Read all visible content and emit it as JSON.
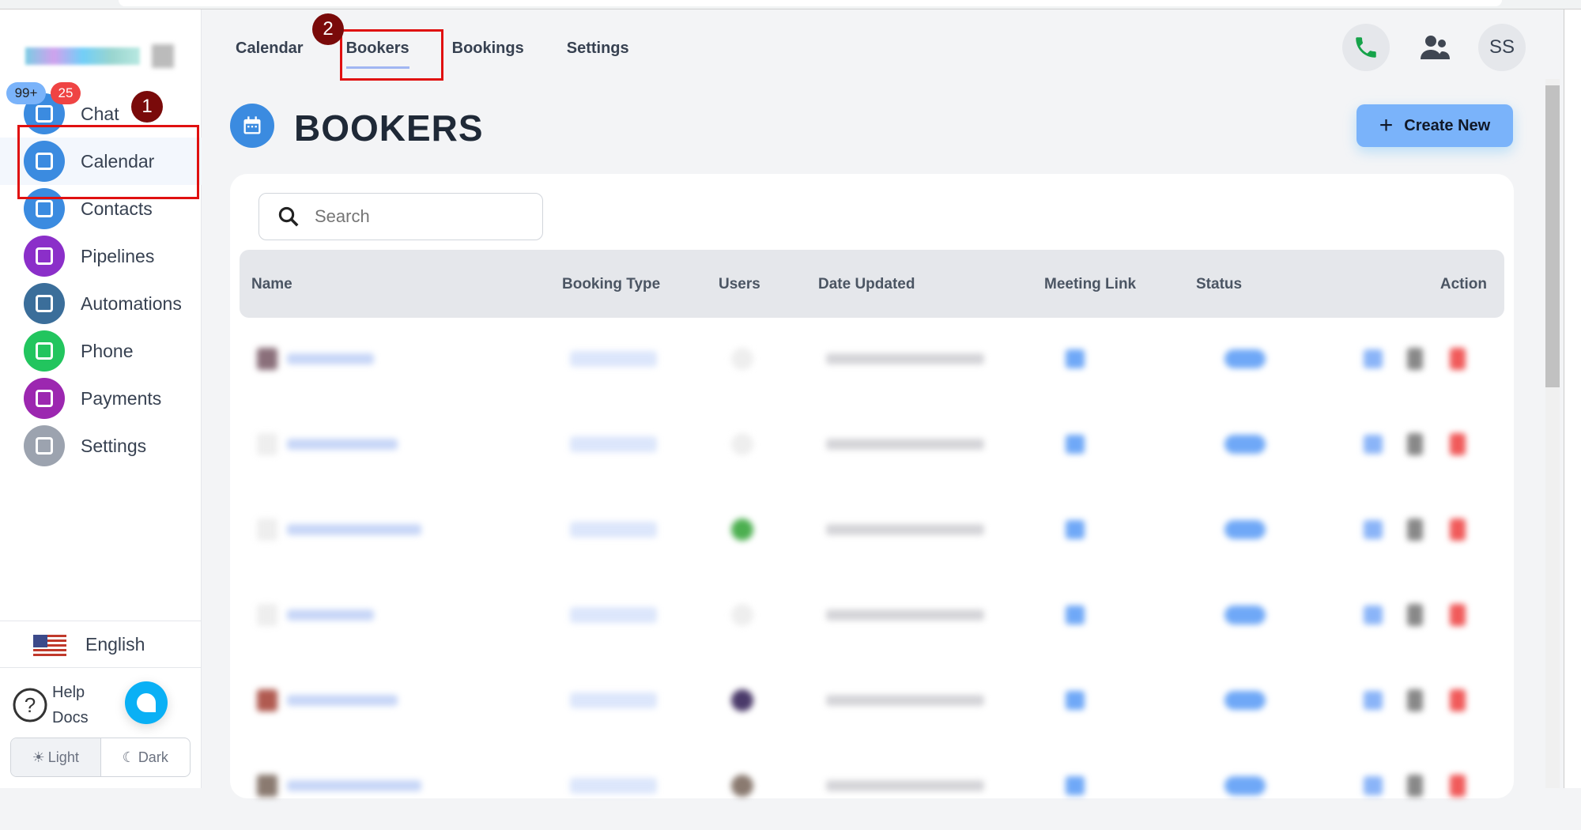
{
  "sidebar": {
    "badges": {
      "unread_all": "99+",
      "unread": "25"
    },
    "items": [
      {
        "label": "Chat",
        "icon": "chat-icon",
        "color": "#3b8be0"
      },
      {
        "label": "Calendar",
        "icon": "calendar-icon",
        "color": "#3b8be0"
      },
      {
        "label": "Contacts",
        "icon": "contacts-icon",
        "color": "#3b8be0"
      },
      {
        "label": "Pipelines",
        "icon": "dollar-icon",
        "color": "#8b2fc9"
      },
      {
        "label": "Automations",
        "icon": "automation-icon",
        "color": "#3b6e9a"
      },
      {
        "label": "Phone",
        "icon": "phone-icon",
        "color": "#22c55e"
      },
      {
        "label": "Payments",
        "icon": "card-icon",
        "color": "#9c27b0"
      },
      {
        "label": "Settings",
        "icon": "gear-icon",
        "color": "#9ca3af"
      }
    ],
    "language": "English",
    "help": {
      "line1": "Help",
      "line2": "Docs"
    },
    "theme": {
      "light": "Light",
      "dark": "Dark"
    }
  },
  "annotations": {
    "step1": "1",
    "step2": "2"
  },
  "tabs": [
    "Calendar",
    "Bookers",
    "Bookings",
    "Settings"
  ],
  "header": {
    "avatar_initials": "SS"
  },
  "page": {
    "title": "BOOKERS",
    "create_button": "Create New"
  },
  "search": {
    "placeholder": "Search",
    "value": ""
  },
  "table": {
    "columns": [
      "Name",
      "Booking Type",
      "Users",
      "Date Updated",
      "Meeting Link",
      "Status",
      "Action"
    ]
  }
}
